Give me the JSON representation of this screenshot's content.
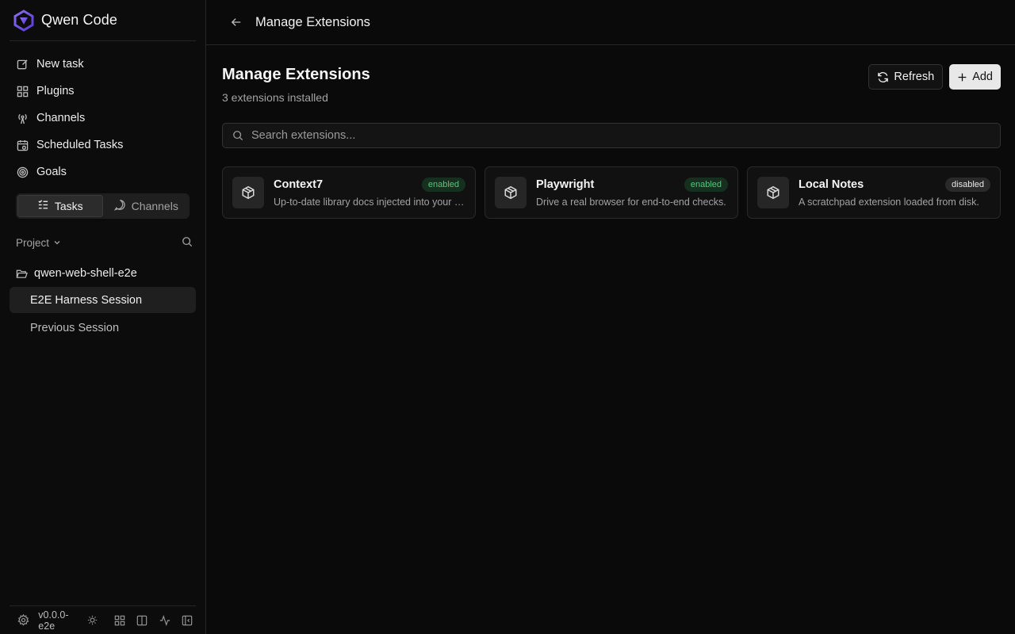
{
  "brand": {
    "name": "Qwen Code"
  },
  "nav": {
    "items": [
      {
        "label": "New task",
        "icon": "edit-icon"
      },
      {
        "label": "Plugins",
        "icon": "plugins-icon"
      },
      {
        "label": "Channels",
        "icon": "broadcast-icon"
      },
      {
        "label": "Scheduled Tasks",
        "icon": "calendar-clock-icon"
      },
      {
        "label": "Goals",
        "icon": "target-icon"
      }
    ]
  },
  "segment": {
    "tasks": "Tasks",
    "channels": "Channels",
    "active": "Tasks"
  },
  "project": {
    "header": "Project",
    "folder": "qwen-web-shell-e2e",
    "sessions": [
      {
        "label": "E2E Harness Session",
        "active": true
      },
      {
        "label": "Previous Session",
        "active": false
      }
    ]
  },
  "footer": {
    "version": "v0.0.0-e2e"
  },
  "topbar": {
    "title": "Manage Extensions"
  },
  "page": {
    "title": "Manage Extensions",
    "subtitle": "3 extensions installed",
    "refresh_label": "Refresh",
    "add_label": "Add",
    "search_placeholder": "Search extensions..."
  },
  "extensions": [
    {
      "name": "Context7",
      "status": "enabled",
      "description": "Up-to-date library docs injected into your prompts."
    },
    {
      "name": "Playwright",
      "status": "enabled",
      "description": "Drive a real browser for end-to-end checks."
    },
    {
      "name": "Local Notes",
      "status": "disabled",
      "description": "A scratchpad extension loaded from disk."
    }
  ],
  "colors": {
    "background": "#0a0a0a",
    "accent_logo": "#6d4ee8",
    "enabled_badge": "#58c47a",
    "border": "#262626"
  }
}
